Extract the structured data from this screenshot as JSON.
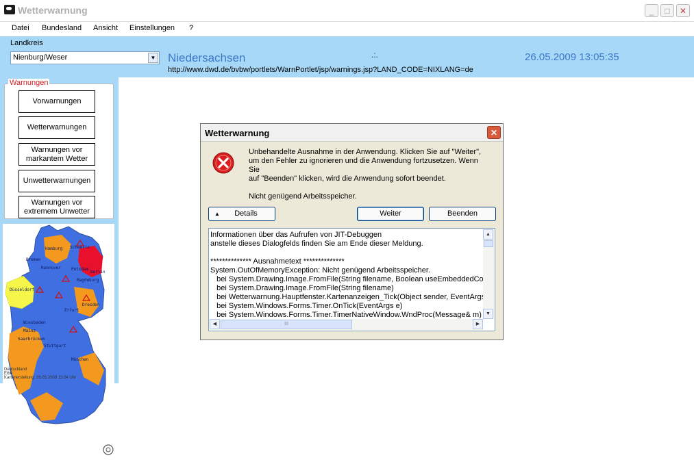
{
  "window": {
    "title": "Wetterwarnung",
    "minimize": "_",
    "maximize": "□",
    "close": "✕"
  },
  "menu": [
    "Datei",
    "Bundesland",
    "Ansicht",
    "Einstellungen",
    "?"
  ],
  "header": {
    "landkreis_label": "Landkreis",
    "landkreis_value": "Nienburg/Weser",
    "state_name": "Niedersachsen",
    "spinner": ".:.",
    "datetime": "26.05.2009 13:05:35",
    "url": "http://www.dwd.de/bvbw/portlets/WarnPortlet/jsp/warnings.jsp?LAND_CODE=NIXLANG=de"
  },
  "warnings": {
    "legend": "Warnungen",
    "buttons": [
      {
        "label": "Vorwarnungen"
      },
      {
        "label": "Wetterwarnungen"
      },
      {
        "label": "Warnungen vor markantem Wetter"
      },
      {
        "label": "Unwetterwarnungen"
      },
      {
        "label": "Warnungen vor extremem Unwetter"
      }
    ]
  },
  "map": {
    "footer_line1": "Deutschland",
    "footer_line2": "Elbe",
    "footer_line3": "Kartenerstellung: 26.05.2009 13:04 Uhr",
    "cities": [
      "Hamburg",
      "Schwerin",
      "Bremen",
      "Hannover",
      "Potsdam",
      "Berlin",
      "Magdeburg",
      "Düsseldorf",
      "Dresden",
      "Erfurt",
      "Wiesbaden",
      "Mainz",
      "Saarbrücken",
      "Stuttgart",
      "München"
    ],
    "colors": {
      "blue": "#3f6fe0",
      "orange": "#f39a1e",
      "yellow": "#f6f64a",
      "red": "#e8102a"
    }
  },
  "dialog": {
    "title": "Wetterwarnung",
    "close": "✕",
    "message_lines": [
      "Unbehandelte Ausnahme in der Anwendung. Klicken Sie auf \"Weiter\",",
      "um den Fehler zu ignorieren und die Anwendung fortzusetzen. Wenn Sie",
      "auf \"Beenden\" klicken, wird die Anwendung sofort beendet."
    ],
    "message_detail": "Nicht genügend Arbeitsspeicher.",
    "details_arrow": "▲",
    "details_button": "Details",
    "continue_button": "Weiter",
    "quit_button": "Beenden",
    "details_text": [
      "Informationen über das Aufrufen von JIT-Debuggen",
      "anstelle dieses Dialogfelds finden Sie am Ende dieser Meldung.",
      "",
      "************** Ausnahmetext **************",
      "System.OutOfMemoryException: Nicht genügend Arbeitsspeicher.",
      "   bei System.Drawing.Image.FromFile(String filename, Boolean useEmbeddedColorM",
      "   bei System.Drawing.Image.FromFile(String filename)",
      "   bei Wetterwarnung.Hauptfenster.Kartenanzeigen_Tick(Object sender, EventArgs e",
      "   bei System.Windows.Forms.Timer.OnTick(EventArgs e)",
      "   bei System.Windows.Forms.Timer.TimerNativeWindow.WndProc(Message& m)"
    ],
    "scroll_up": "▲",
    "scroll_down": "▼",
    "scroll_left": "◀",
    "scroll_right": "▶",
    "thumb_grip": "III"
  }
}
